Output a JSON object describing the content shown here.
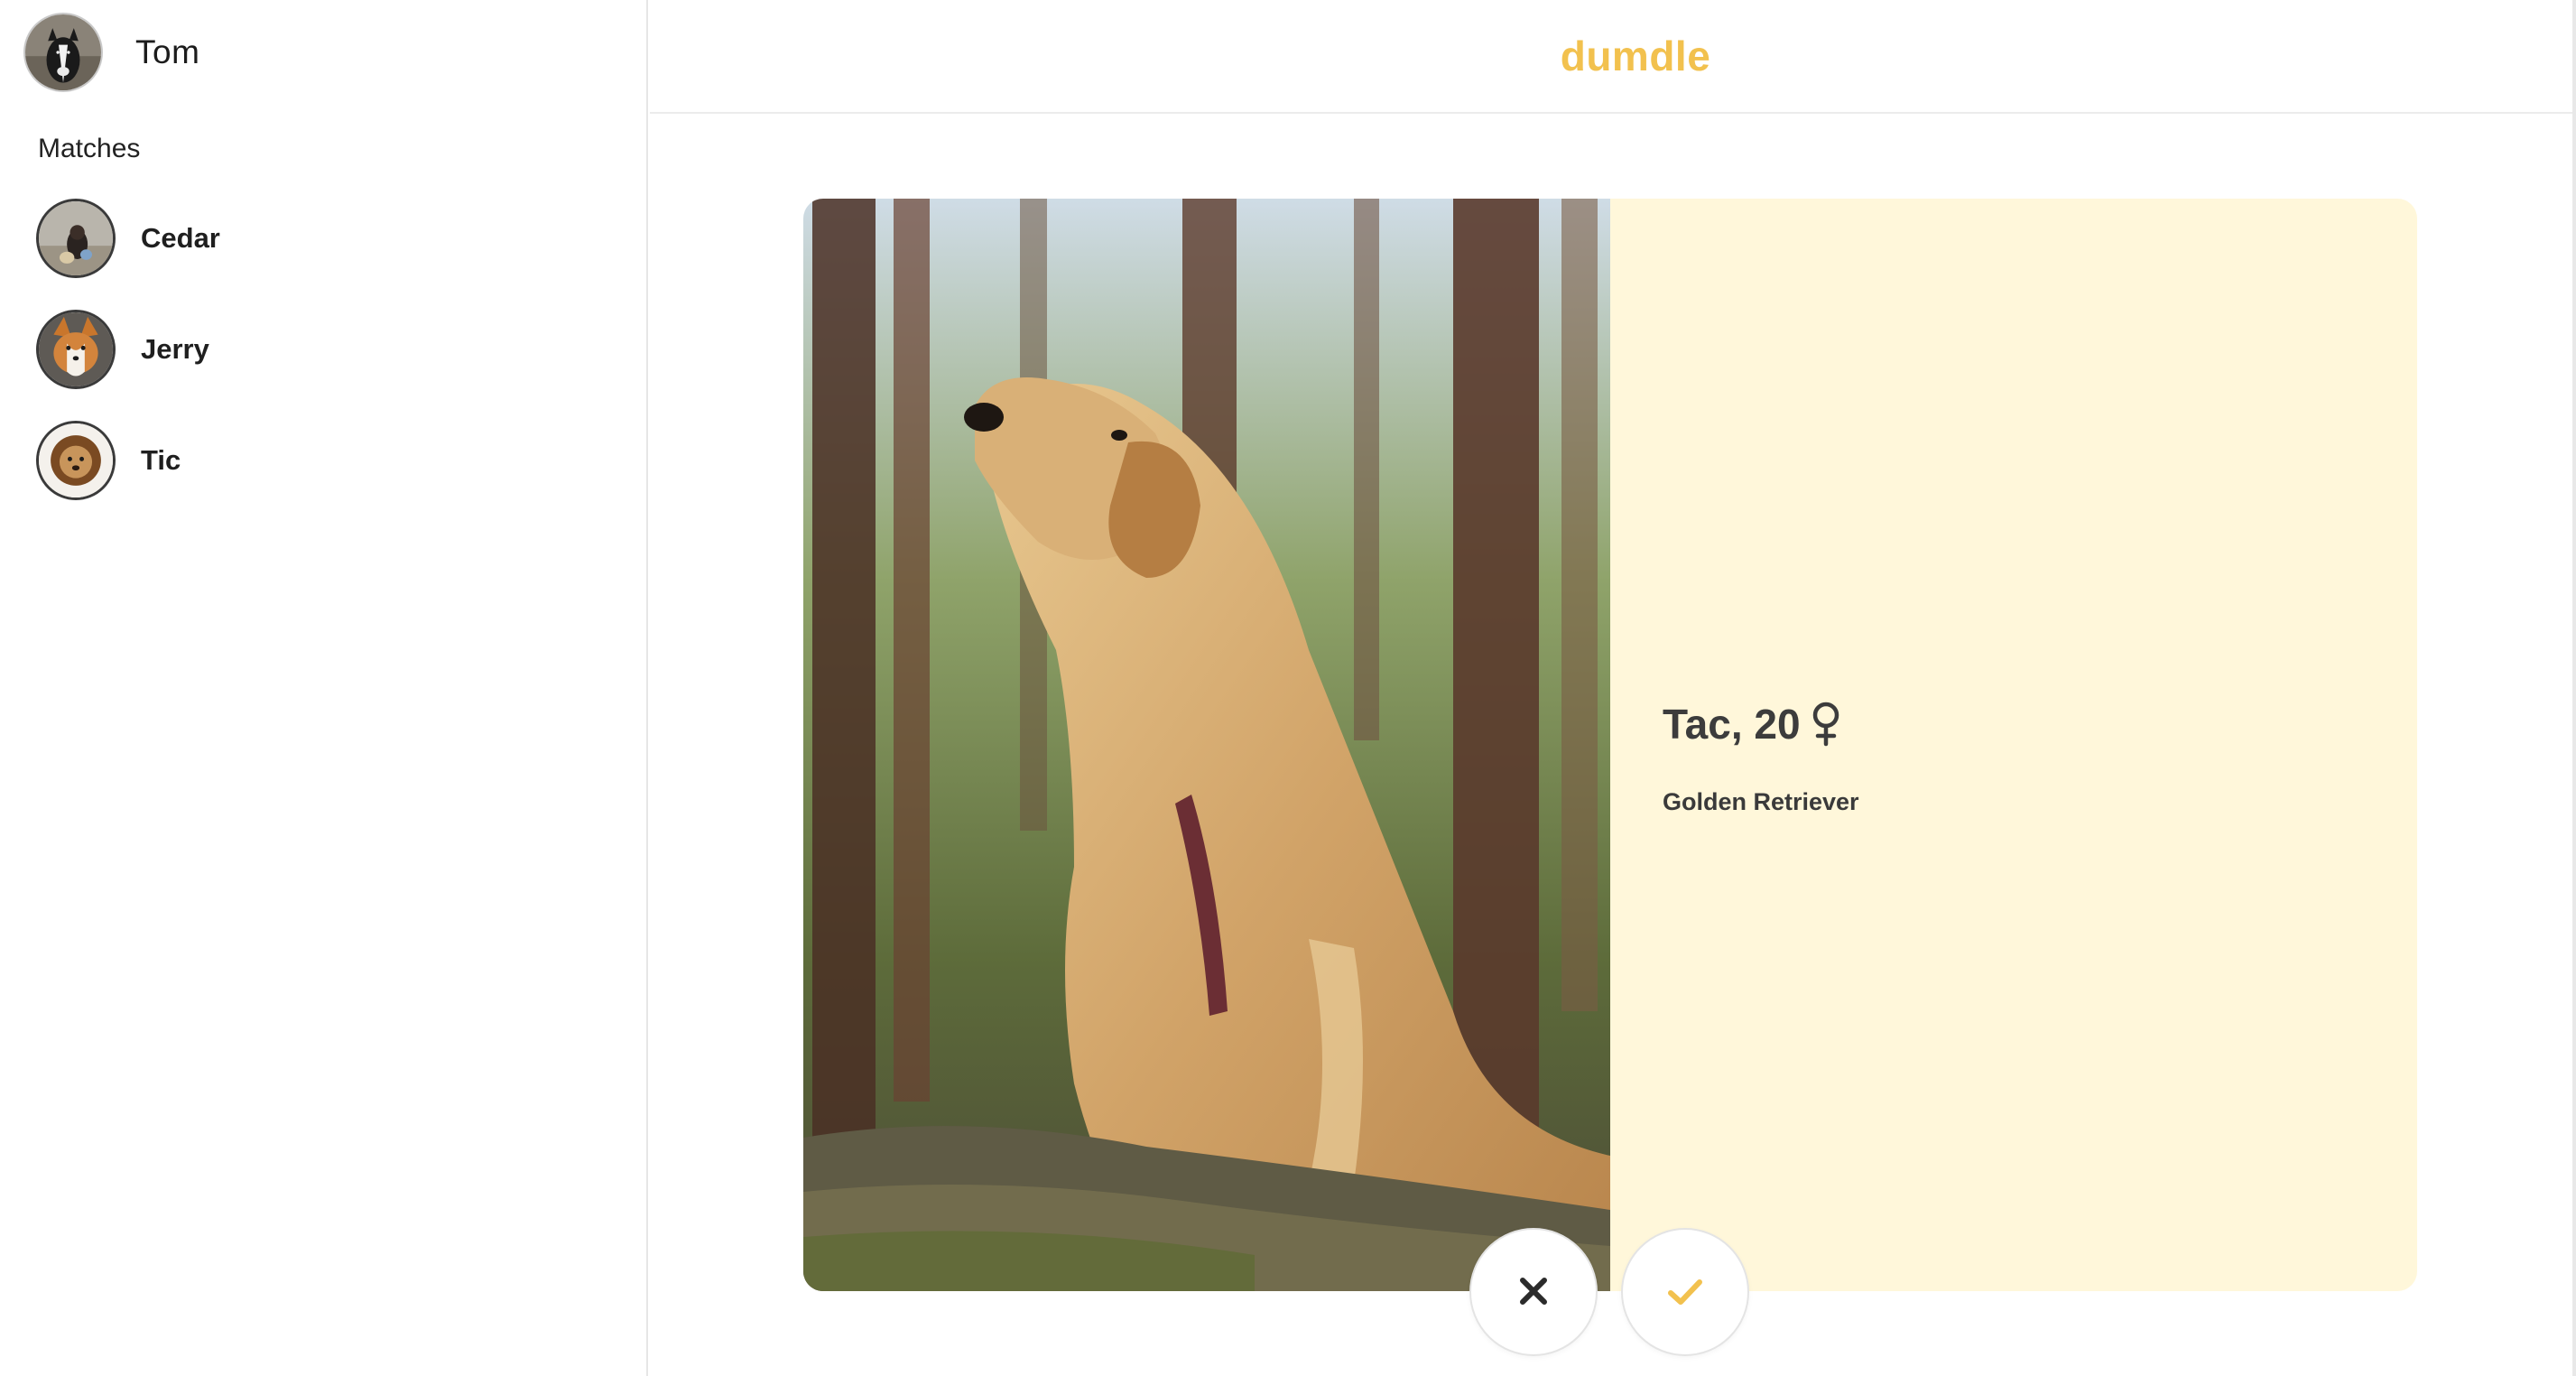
{
  "user": {
    "name": "Tom"
  },
  "sidebar": {
    "matches_label": "Matches",
    "matches": [
      {
        "name": "Cedar"
      },
      {
        "name": "Jerry"
      },
      {
        "name": "Tic"
      }
    ]
  },
  "header": {
    "brand": "dumdle"
  },
  "profile": {
    "title": "Tac, 20",
    "gender": "female",
    "breed": "Golden Retriever"
  },
  "actions": {
    "reject_icon": "close-icon",
    "like_icon": "check-icon"
  },
  "colors": {
    "brand": "#f2c14e",
    "info_panel_bg": "#fff7da",
    "text_dark": "#3c3c3c",
    "like_check": "#f2c14e",
    "reject_x": "#2b2b2b"
  }
}
